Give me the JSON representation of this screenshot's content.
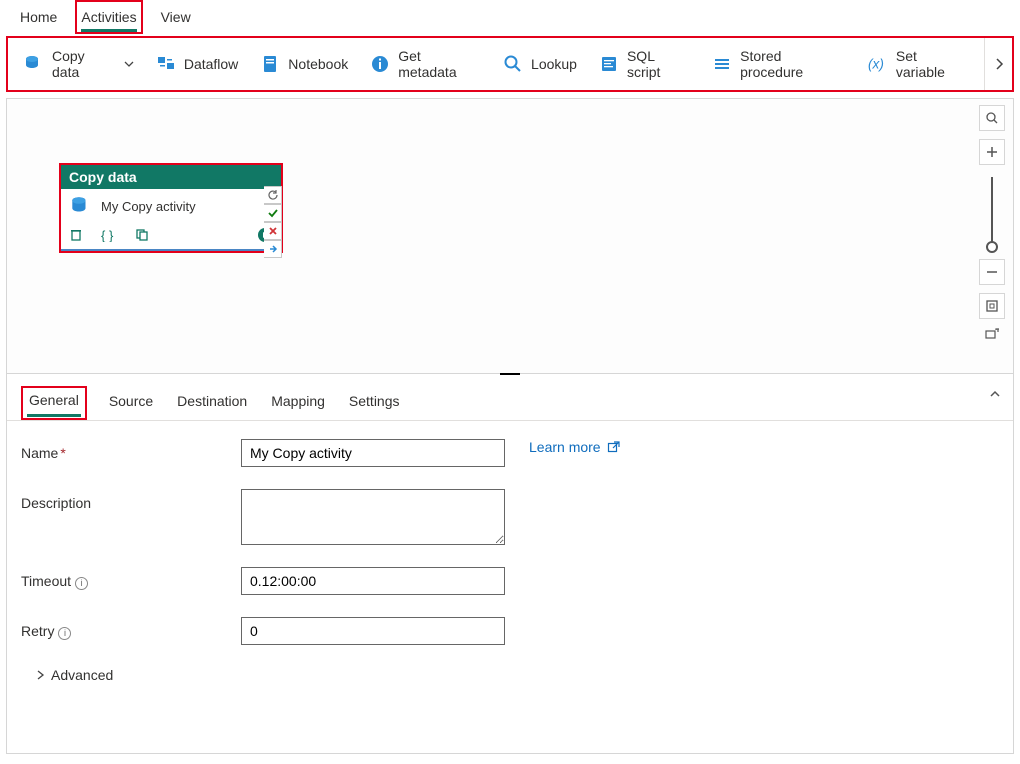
{
  "topmenu": {
    "home": "Home",
    "activities": "Activities",
    "view": "View"
  },
  "toolbar": {
    "copy_data": "Copy data",
    "dataflow": "Dataflow",
    "notebook": "Notebook",
    "get_metadata": "Get metadata",
    "lookup": "Lookup",
    "sql_script": "SQL script",
    "stored_proc": "Stored procedure",
    "set_variable": "Set variable"
  },
  "activity": {
    "type": "Copy data",
    "name": "My Copy activity"
  },
  "props": {
    "tabs": {
      "general": "General",
      "source": "Source",
      "destination": "Destination",
      "mapping": "Mapping",
      "settings": "Settings"
    },
    "learn_more": "Learn more",
    "name_label": "Name",
    "name_value": "My Copy activity",
    "desc_label": "Description",
    "desc_value": "",
    "timeout_label": "Timeout",
    "timeout_value": "0.12:00:00",
    "retry_label": "Retry",
    "retry_value": "0",
    "advanced": "Advanced"
  }
}
